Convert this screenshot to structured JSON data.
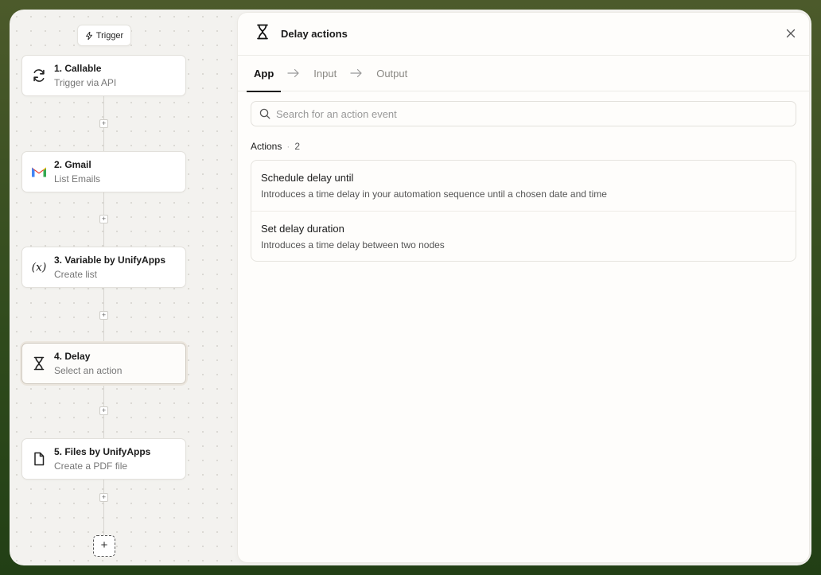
{
  "canvas": {
    "trigger_label": "Trigger",
    "nodes": [
      {
        "title": "1. Callable",
        "subtitle": "Trigger via API",
        "icon": "refresh-icon"
      },
      {
        "title": "2. Gmail",
        "subtitle": "List Emails",
        "icon": "gmail-icon"
      },
      {
        "title": "3. Variable by UnifyApps",
        "subtitle": "Create list",
        "icon": "variable-icon"
      },
      {
        "title": "4. Delay",
        "subtitle": "Select an action",
        "icon": "hourglass-icon"
      },
      {
        "title": "5. Files by UnifyApps",
        "subtitle": "Create a PDF file",
        "icon": "file-icon"
      }
    ],
    "add_label": "+"
  },
  "panel": {
    "title": "Delay actions",
    "tabs": [
      {
        "label": "App",
        "active": true
      },
      {
        "label": "Input",
        "active": false
      },
      {
        "label": "Output",
        "active": false
      }
    ],
    "search": {
      "placeholder": "Search for an action event"
    },
    "section": {
      "label": "Actions",
      "count": "2"
    },
    "actions": [
      {
        "title": "Schedule delay until",
        "description": "Introduces a time delay in your automation sequence until a chosen date and time"
      },
      {
        "title": "Set delay duration",
        "description": "Introduces a time delay between two nodes"
      }
    ]
  },
  "colors": {
    "outer_background": "#3b4f22",
    "canvas_background": "#f3f2ef",
    "panel_background": "#fefdfb"
  }
}
